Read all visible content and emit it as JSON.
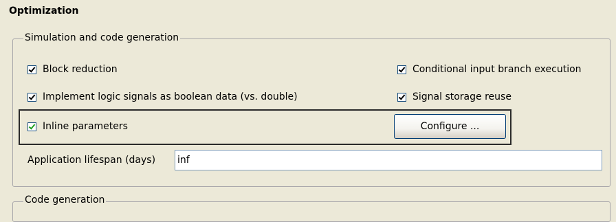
{
  "page_title": "Optimization",
  "sim_group": {
    "legend": "Simulation and code generation",
    "block_reduction": {
      "label": "Block reduction",
      "checked": true
    },
    "conditional_branch": {
      "label": "Conditional input branch execution",
      "checked": true
    },
    "implement_logic": {
      "label": "Implement logic signals as boolean data (vs. double)",
      "checked": true
    },
    "signal_storage": {
      "label": "Signal storage reuse",
      "checked": true
    },
    "inline_params": {
      "label": "Inline parameters",
      "checked": true
    },
    "configure_button": "Configure ...",
    "lifespan_label": "Application lifespan (days)",
    "lifespan_value": "inf"
  },
  "code_group": {
    "legend": "Code generation"
  },
  "colors": {
    "background": "#ece9d8",
    "checkmark": "#21a121",
    "highlight_border": "#2a2a2a"
  }
}
